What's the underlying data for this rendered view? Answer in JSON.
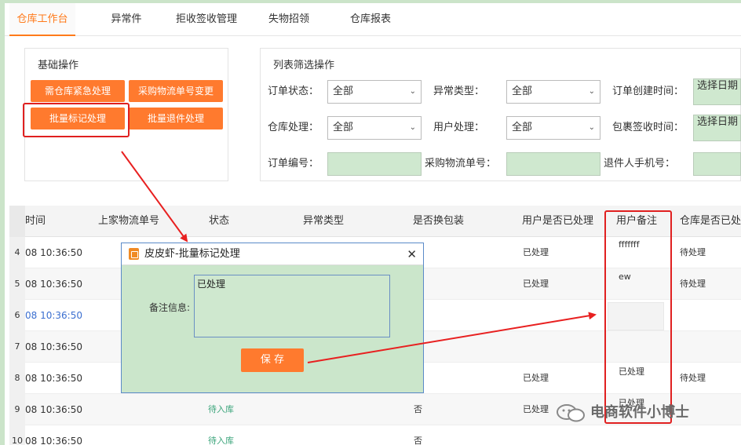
{
  "tabs": [
    {
      "label": "仓库工作台",
      "active": true
    },
    {
      "label": "异常件"
    },
    {
      "label": "拒收签收管理"
    },
    {
      "label": "失物招领"
    },
    {
      "label": "仓库报表"
    }
  ],
  "basic_ops": {
    "title": "基础操作",
    "buttons": [
      "需仓库紧急处理",
      "采购物流单号变更",
      "批量标记处理",
      "批量退件处理"
    ]
  },
  "filters": {
    "title": "列表筛选操作",
    "order_status": {
      "label": "订单状态：",
      "value": "全部"
    },
    "exception_type": {
      "label": "异常类型：",
      "value": "全部"
    },
    "create_time": {
      "label": "订单创建时间：",
      "value": "选择日期"
    },
    "warehouse_handle": {
      "label": "仓库处理：",
      "value": "全部"
    },
    "user_handle": {
      "label": "用户处理：",
      "value": "全部"
    },
    "sign_time": {
      "label": "包裹签收时间：",
      "value": "选择日期"
    },
    "order_no": {
      "label": "订单编号："
    },
    "purchase_no": {
      "label": "采购物流单号："
    },
    "return_phone": {
      "label": "退件人手机号："
    }
  },
  "table": {
    "headers": [
      "时间",
      "上家物流单号",
      "状态",
      "异常类型",
      "是否换包装",
      "用户是否已处理",
      "用户备注",
      "仓库是否已处"
    ],
    "rows": [
      {
        "idx": "4",
        "time": "08 10:36:50",
        "status": "",
        "repack": "",
        "user_done": "已处理",
        "note": "fffffff",
        "wh": "待处理"
      },
      {
        "idx": "5",
        "time": "08 10:36:50",
        "status": "",
        "repack": "",
        "user_done": "已处理",
        "note": "ew",
        "wh": "待处理"
      },
      {
        "idx": "6",
        "time": "08 10:36:50",
        "status": "",
        "repack": "",
        "user_done": "",
        "note": "",
        "wh": ""
      },
      {
        "idx": "7",
        "time": "08 10:36:50",
        "status": "",
        "repack": "",
        "user_done": "",
        "note": "",
        "wh": ""
      },
      {
        "idx": "8",
        "time": "08 10:36:50",
        "status": "",
        "repack": "",
        "user_done": "已处理",
        "note": "已处理",
        "wh": "待处理"
      },
      {
        "idx": "9",
        "time": "08 10:36:50",
        "status": "待入库",
        "repack": "否",
        "user_done": "已处理",
        "note": "已处理",
        "wh": ""
      },
      {
        "idx": "10",
        "time": "08 10:36:50",
        "status": "待入库",
        "repack": "否",
        "user_done": "",
        "note": "",
        "wh": ""
      }
    ]
  },
  "dialog": {
    "title": "皮皮虾-批量标记处理",
    "note_label": "备注信息:",
    "note_value": "已处理",
    "save_label": "保 存"
  },
  "watermark": {
    "text": "电商软件小博士"
  },
  "colors": {
    "accent": "#ff7a2e",
    "highlight_red": "#e02020",
    "green_input": "#cfe8cf"
  }
}
